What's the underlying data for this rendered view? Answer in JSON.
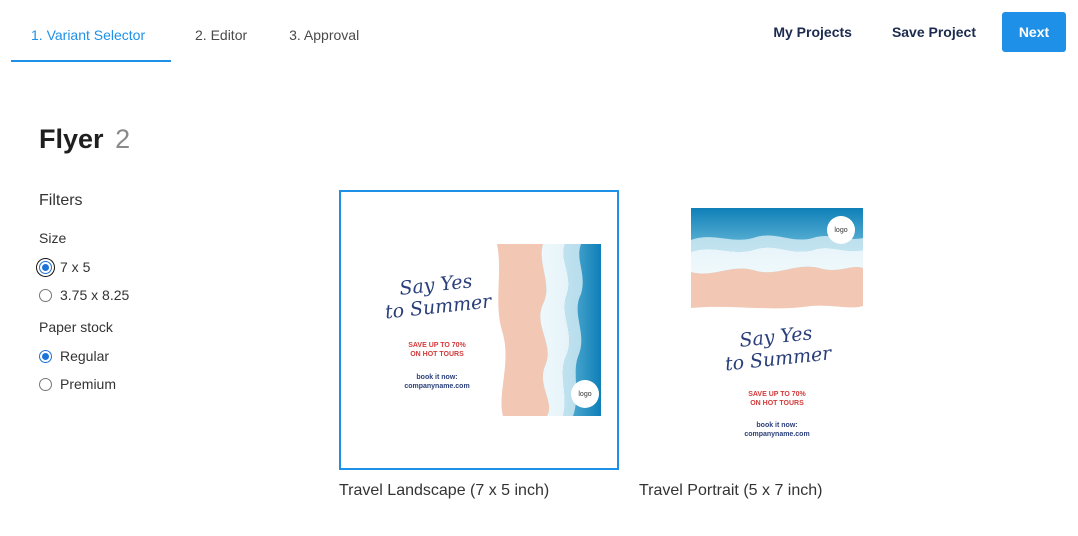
{
  "nav": {
    "steps": [
      {
        "label": "1. Variant Selector"
      },
      {
        "label": "2. Editor"
      },
      {
        "label": "3. Approval"
      }
    ],
    "my_projects": "My Projects",
    "save_project": "Save Project",
    "next": "Next"
  },
  "page": {
    "title": "Flyer",
    "count": "2"
  },
  "filters": {
    "title": "Filters",
    "size": {
      "label": "Size",
      "options": [
        "7 x 5",
        "3.75 x 8.25"
      ],
      "selected": "7 x 5"
    },
    "paper_stock": {
      "label": "Paper stock",
      "options": [
        "Regular",
        "Premium"
      ],
      "selected": "Regular"
    }
  },
  "variants": [
    {
      "label": "Travel Landscape (7 x 5 inch)",
      "selected": true,
      "headline": [
        "Say Yes",
        "to Summer"
      ],
      "promo": [
        "SAVE UP TO 70%",
        "ON HOT TOURS"
      ],
      "book": [
        "book it now:",
        "companyname.com"
      ],
      "logo": "logo"
    },
    {
      "label": "Travel Portrait (5 x 7 inch)",
      "selected": false,
      "headline": [
        "Say Yes",
        "to Summer"
      ],
      "promo": [
        "SAVE UP TO 70%",
        "ON HOT TOURS"
      ],
      "book": [
        "book it now:",
        "companyname.com"
      ],
      "logo": "logo"
    }
  ],
  "colors": {
    "accent": "#1e90e8",
    "nav_text_dark": "#1b2a4e",
    "headline": "#2a3f7a",
    "promo": "#d43a3a",
    "sand": "#f2c7b4",
    "sea": "#1b8fc4"
  }
}
